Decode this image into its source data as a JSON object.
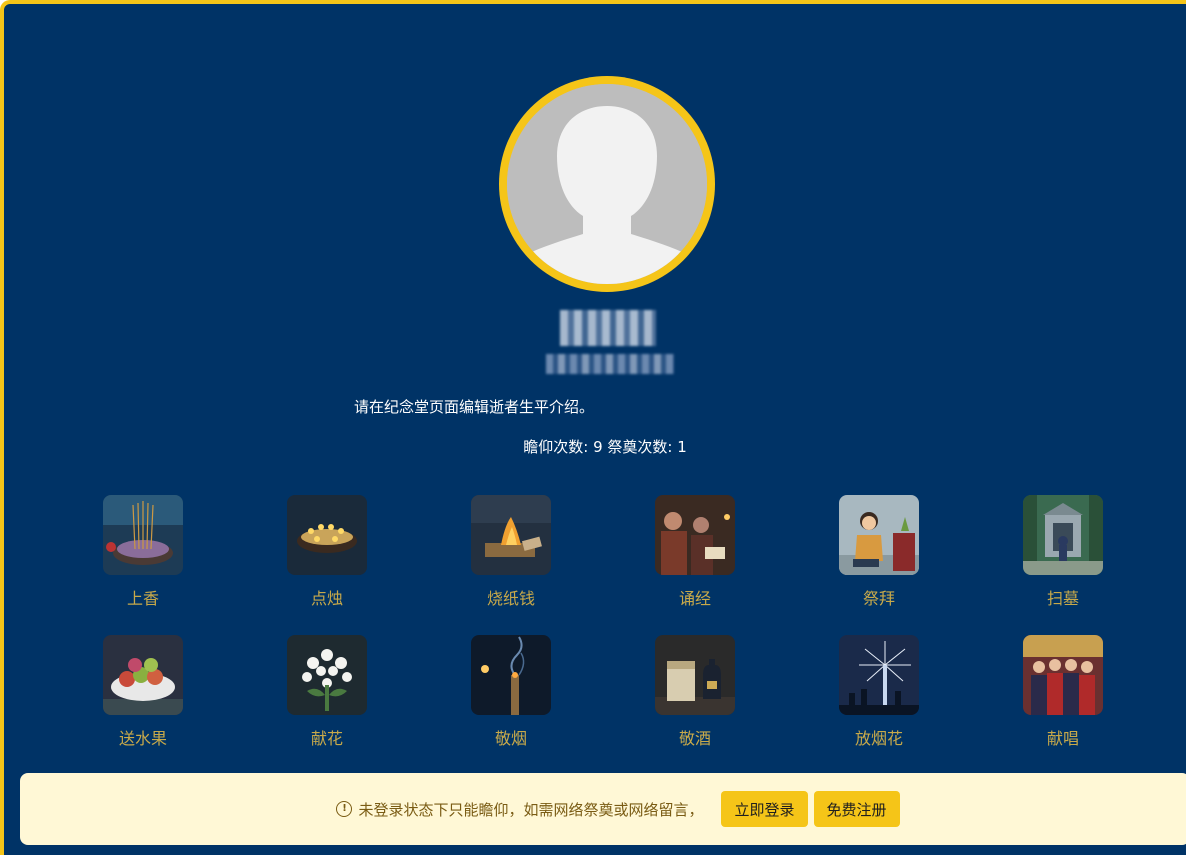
{
  "memorial": {
    "bio_text": "请在纪念堂页面编辑逝者生平介绍。",
    "stats_text": "瞻仰次数: 9 祭奠次数: 1"
  },
  "offerings": [
    {
      "label": "上香",
      "icon": "incense-icon"
    },
    {
      "label": "点烛",
      "icon": "candles-icon"
    },
    {
      "label": "烧纸钱",
      "icon": "paper-money-icon"
    },
    {
      "label": "诵经",
      "icon": "chanting-icon"
    },
    {
      "label": "祭拜",
      "icon": "worship-icon"
    },
    {
      "label": "扫墓",
      "icon": "tomb-sweeping-icon"
    },
    {
      "label": "送水果",
      "icon": "fruit-icon"
    },
    {
      "label": "献花",
      "icon": "flowers-icon"
    },
    {
      "label": "敬烟",
      "icon": "cigarette-icon"
    },
    {
      "label": "敬酒",
      "icon": "liquor-icon"
    },
    {
      "label": "放烟花",
      "icon": "fireworks-icon"
    },
    {
      "label": "献唱",
      "icon": "singing-icon"
    }
  ],
  "notice": {
    "text": "未登录状态下只能瞻仰，如需网络祭奠或网络留言，",
    "login_label": "立即登录",
    "register_label": "免费注册"
  },
  "colors": {
    "background": "#003366",
    "accent": "#f5c518",
    "offering_label": "#c7a94a",
    "notice_bg": "#fff8d6"
  }
}
